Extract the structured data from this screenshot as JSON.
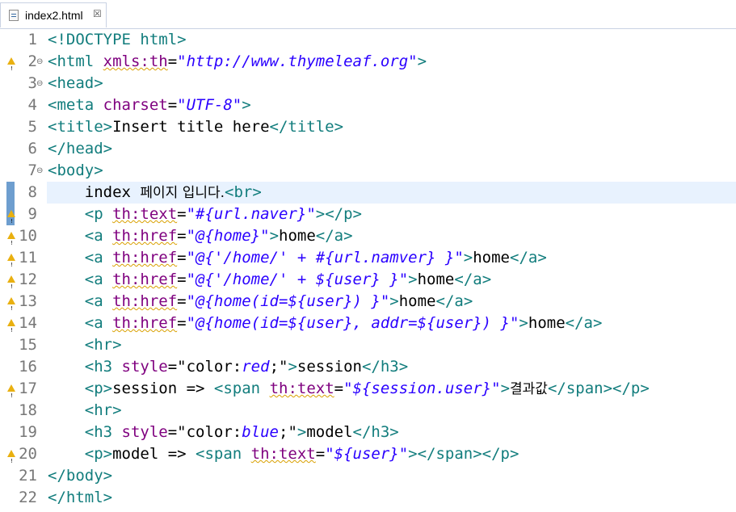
{
  "tab": {
    "filename": "index2.html",
    "close_glyph": "☒"
  },
  "lines": [
    {
      "n": "1",
      "fold": "",
      "warn": false,
      "segs": [
        [
          "t",
          "<!DOCTYPE html>"
        ]
      ]
    },
    {
      "n": "2",
      "fold": "⊖",
      "warn": true,
      "segs": [
        [
          "t",
          "<html "
        ],
        [
          "a",
          "xmls:th"
        ],
        [
          "p",
          "="
        ],
        [
          "v",
          "\"http://www.thymeleaf.org\""
        ],
        [
          "t",
          ">"
        ]
      ]
    },
    {
      "n": "3",
      "fold": "⊖",
      "warn": false,
      "segs": [
        [
          "t",
          "<head>"
        ]
      ]
    },
    {
      "n": "4",
      "fold": "",
      "warn": false,
      "segs": [
        [
          "t",
          "<meta "
        ],
        [
          "a",
          "charset"
        ],
        [
          "p",
          "="
        ],
        [
          "v",
          "\"UTF-8\""
        ],
        [
          "t",
          ">"
        ]
      ]
    },
    {
      "n": "5",
      "fold": "",
      "warn": false,
      "segs": [
        [
          "t",
          "<title>"
        ],
        [
          "k",
          "Insert title here"
        ],
        [
          "t",
          "</title>"
        ]
      ]
    },
    {
      "n": "6",
      "fold": "",
      "warn": false,
      "segs": [
        [
          "t",
          "</head>"
        ]
      ]
    },
    {
      "n": "7",
      "fold": "⊖",
      "warn": false,
      "segs": [
        [
          "t",
          "<body>"
        ]
      ]
    },
    {
      "n": "8",
      "fold": "",
      "warn": false,
      "current": true,
      "marker": true,
      "segs": [
        [
          "k",
          "    index "
        ],
        [
          "kor",
          "페이지 입니다."
        ],
        [
          "t",
          "<br>"
        ]
      ]
    },
    {
      "n": "9",
      "fold": "",
      "warn": true,
      "marker": true,
      "segs": [
        [
          "t",
          "    <p "
        ],
        [
          "a",
          "th:text"
        ],
        [
          "p",
          "="
        ],
        [
          "v",
          "\"#{url.naver}\""
        ],
        [
          "t",
          "></p>"
        ]
      ]
    },
    {
      "n": "10",
      "fold": "",
      "warn": true,
      "segs": [
        [
          "t",
          "    <a "
        ],
        [
          "a",
          "th:href"
        ],
        [
          "p",
          "="
        ],
        [
          "v",
          "\"@{home}\""
        ],
        [
          "t",
          ">"
        ],
        [
          "k",
          "home"
        ],
        [
          "t",
          "</a>"
        ]
      ]
    },
    {
      "n": "11",
      "fold": "",
      "warn": true,
      "segs": [
        [
          "t",
          "    <a "
        ],
        [
          "a",
          "th:href"
        ],
        [
          "p",
          "="
        ],
        [
          "v",
          "\"@{'/home/' + #{url.namver} }\""
        ],
        [
          "t",
          ">"
        ],
        [
          "k",
          "home"
        ],
        [
          "t",
          "</a>"
        ]
      ]
    },
    {
      "n": "12",
      "fold": "",
      "warn": true,
      "segs": [
        [
          "t",
          "    <a "
        ],
        [
          "a",
          "th:href"
        ],
        [
          "p",
          "="
        ],
        [
          "v",
          "\"@{'/home/' + ${user} }\""
        ],
        [
          "t",
          ">"
        ],
        [
          "k",
          "home"
        ],
        [
          "t",
          "</a>"
        ]
      ]
    },
    {
      "n": "13",
      "fold": "",
      "warn": true,
      "segs": [
        [
          "t",
          "    <a "
        ],
        [
          "a",
          "th:href"
        ],
        [
          "p",
          "="
        ],
        [
          "v",
          "\"@{home(id=${user}) }\""
        ],
        [
          "t",
          ">"
        ],
        [
          "k",
          "home"
        ],
        [
          "t",
          "</a>"
        ]
      ]
    },
    {
      "n": "14",
      "fold": "",
      "warn": true,
      "segs": [
        [
          "t",
          "    <a "
        ],
        [
          "a",
          "th:href"
        ],
        [
          "p",
          "="
        ],
        [
          "v",
          "\"@{home(id=${user}, addr=${user}) }\""
        ],
        [
          "t",
          ">"
        ],
        [
          "k",
          "home"
        ],
        [
          "t",
          "</a>"
        ]
      ]
    },
    {
      "n": "15",
      "fold": "",
      "warn": false,
      "segs": [
        [
          "t",
          "    <hr>"
        ]
      ]
    },
    {
      "n": "16",
      "fold": "",
      "warn": false,
      "segs": [
        [
          "t",
          "    <h3 "
        ],
        [
          "a",
          "style"
        ],
        [
          "p",
          "=\"color:"
        ],
        [
          "v",
          "red"
        ],
        [
          "p",
          ";\""
        ],
        [
          "t",
          ">"
        ],
        [
          "k",
          "session"
        ],
        [
          "t",
          "</h3>"
        ]
      ]
    },
    {
      "n": "17",
      "fold": "",
      "warn": true,
      "segs": [
        [
          "t",
          "    <p>"
        ],
        [
          "k",
          "session => "
        ],
        [
          "t",
          "<span "
        ],
        [
          "a",
          "th:text"
        ],
        [
          "p",
          "="
        ],
        [
          "v",
          "\"${session.user}\""
        ],
        [
          "t",
          ">"
        ],
        [
          "kor",
          "결과값"
        ],
        [
          "t",
          "</span></p>"
        ]
      ]
    },
    {
      "n": "18",
      "fold": "",
      "warn": false,
      "segs": [
        [
          "t",
          "    <hr>"
        ]
      ]
    },
    {
      "n": "19",
      "fold": "",
      "warn": false,
      "segs": [
        [
          "t",
          "    <h3 "
        ],
        [
          "a",
          "style"
        ],
        [
          "p",
          "=\"color:"
        ],
        [
          "v",
          "blue"
        ],
        [
          "p",
          ";\""
        ],
        [
          "t",
          ">"
        ],
        [
          "k",
          "model"
        ],
        [
          "t",
          "</h3>"
        ]
      ]
    },
    {
      "n": "20",
      "fold": "",
      "warn": true,
      "segs": [
        [
          "t",
          "    <p>"
        ],
        [
          "k",
          "model => "
        ],
        [
          "t",
          "<span "
        ],
        [
          "a",
          "th:text"
        ],
        [
          "p",
          "="
        ],
        [
          "v",
          "\"${user}\""
        ],
        [
          "t",
          "></span></p>"
        ]
      ]
    },
    {
      "n": "21",
      "fold": "",
      "warn": false,
      "segs": [
        [
          "t",
          "</body>"
        ]
      ]
    },
    {
      "n": "22",
      "fold": "",
      "warn": false,
      "segs": [
        [
          "t",
          "</html>"
        ]
      ]
    }
  ]
}
